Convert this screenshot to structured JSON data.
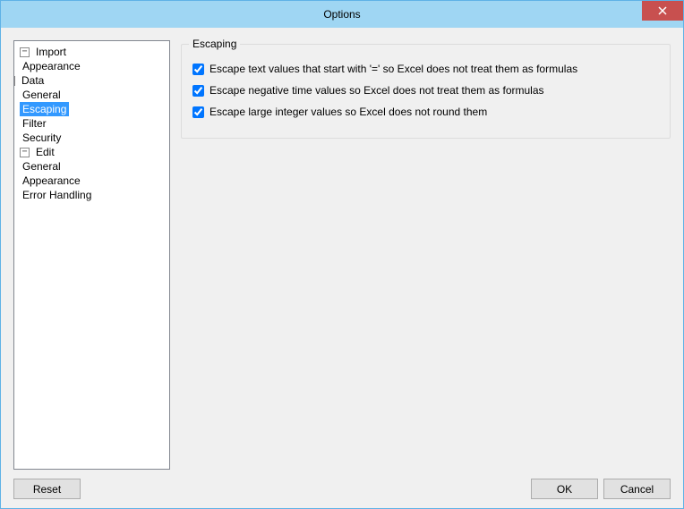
{
  "window": {
    "title": "Options"
  },
  "tree": {
    "import": {
      "label": "Import",
      "toggle": "−",
      "appearance": "Appearance",
      "data": {
        "label": "Data",
        "toggle": "−",
        "general": "General",
        "escaping": "Escaping"
      },
      "filter": "Filter",
      "security": "Security"
    },
    "edit": {
      "label": "Edit",
      "toggle": "−",
      "general": "General",
      "appearance": "Appearance",
      "error_handling": "Error Handling"
    }
  },
  "group": {
    "title": "Escaping",
    "opt1": "Escape text values that start with '=' so Excel does not treat them as formulas",
    "opt2": "Escape negative time values so Excel does not treat them as formulas",
    "opt3": "Escape large integer values so Excel does not round them"
  },
  "buttons": {
    "reset": "Reset",
    "ok": "OK",
    "cancel": "Cancel"
  }
}
